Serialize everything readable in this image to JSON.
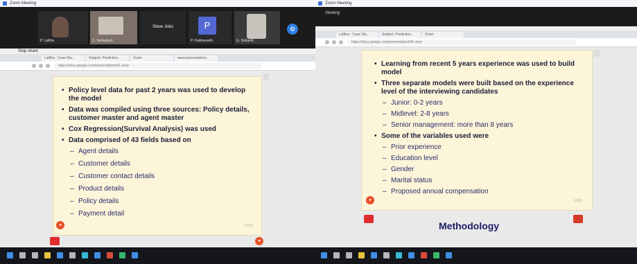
{
  "colors": {
    "slide_background": "#fcf5d9",
    "slide_text": "#1f1f3a",
    "sub_text": "#2a2a6a",
    "meeting_strip": "#1b1b1b",
    "taskbar": "#14161c",
    "accent_blue": "#3b6fd6",
    "logo_orange": "#e8532a"
  },
  "left": {
    "window_title": "Zoom Meeting",
    "participants": [
      {
        "name": "P. Lalitha"
      },
      {
        "name": "C. Venkatesh"
      },
      {
        "name": "Steve Jobs"
      },
      {
        "name": "P. Padmavathi",
        "initial": "P"
      },
      {
        "name": "G. Srikanth"
      }
    ],
    "status_label": "Stop share",
    "browser_tabs": [
      "Lalitha - Case Stu...",
      "Subject: Prediction...",
      "Zoom",
      "www.prezentations..."
    ],
    "address": "https://docs.google.com/presentation/d/1-view",
    "slide": {
      "bullets": [
        {
          "level": 1,
          "text": "Policy level data for past 2 years was used to develop the model"
        },
        {
          "level": 1,
          "text": "Data was compiled using three sources: Policy details, customer master and agent master"
        },
        {
          "level": 1,
          "text": "Cox Regression(Survival Analysis) was used"
        },
        {
          "level": 1,
          "text": "Data comprised of 43 fields based on"
        },
        {
          "level": 2,
          "text": "Agent details"
        },
        {
          "level": 2,
          "text": "Customer details"
        },
        {
          "level": 2,
          "text": "Customer contact details"
        },
        {
          "level": 2,
          "text": "Product details"
        },
        {
          "level": 2,
          "text": "Policy details"
        },
        {
          "level": 2,
          "text": "Payment detail"
        }
      ],
      "slide_number": "12/20"
    },
    "taskbar_icons": [
      "start-icon",
      "search-icon",
      "task-view-icon",
      "file-explorer-icon",
      "store-icon",
      "mail-icon",
      "calendar-icon",
      "word-icon",
      "powerpoint-icon",
      "chrome-icon",
      "zoom-icon"
    ]
  },
  "right": {
    "window_title": "Zoom Meeting",
    "status_label": "Viewing",
    "browser_tabs": [
      "Lalitha - Case Stu...",
      "Subject: Prediction...",
      "Zoom"
    ],
    "address": "https://docs.google.com/presentation/d/1-view",
    "slide": {
      "bullets": [
        {
          "level": 1,
          "text": "Learning from recent 5 years experience was used to build model"
        },
        {
          "level": 1,
          "text": "Three separate models were built based on the experience level of the interviewing candidates"
        },
        {
          "level": 2,
          "text": "Junior: 0-2 years"
        },
        {
          "level": 2,
          "text": "Midlevel: 2-8 years"
        },
        {
          "level": 2,
          "text": "Senior management: more than 8 years"
        },
        {
          "level": 1,
          "text": "Some of the variables used were"
        },
        {
          "level": 2,
          "text": "Prior experience"
        },
        {
          "level": 2,
          "text": "Education level"
        },
        {
          "level": 2,
          "text": "Gender"
        },
        {
          "level": 2,
          "text": "Marital status"
        },
        {
          "level": 2,
          "text": "Proposed annual compensation"
        }
      ],
      "slide_number": "13/20"
    },
    "next_slide_heading": "Methodology",
    "taskbar_icons": [
      "start-icon",
      "search-icon",
      "task-view-icon",
      "file-explorer-icon",
      "store-icon",
      "mail-icon",
      "calendar-icon",
      "word-icon",
      "powerpoint-icon",
      "chrome-icon",
      "zoom-icon"
    ]
  }
}
